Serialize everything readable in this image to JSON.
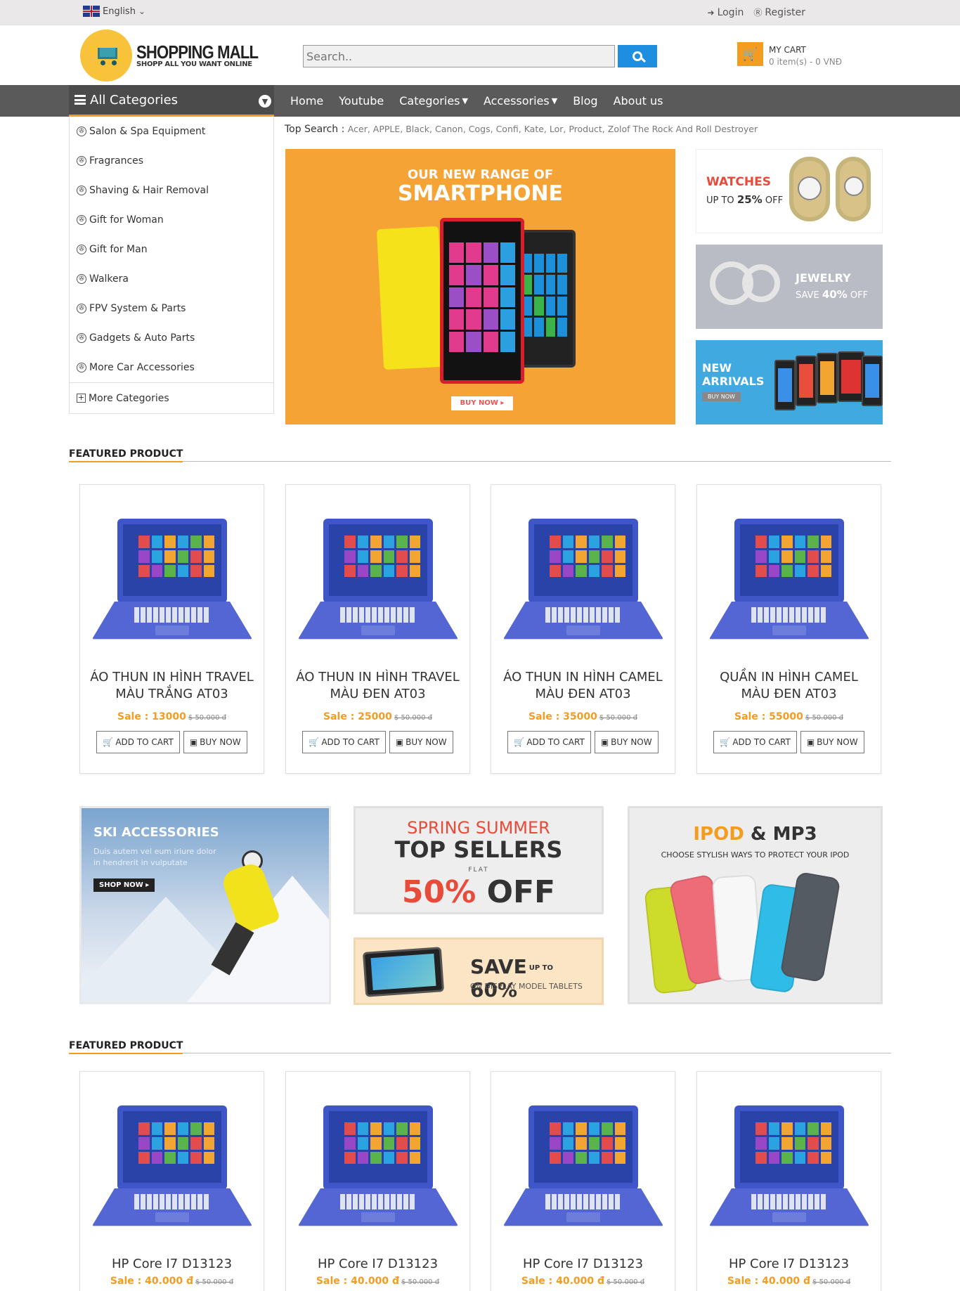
{
  "topbar": {
    "language": "English",
    "login": "Login",
    "register": "Register"
  },
  "logo": {
    "title": "SHOPPING MALL",
    "tagline": "SHOPP ALL YOU WANT ONLINE"
  },
  "search": {
    "placeholder": "Search.."
  },
  "cart": {
    "title": "MY CART",
    "summary": "0 item(s) - 0 VNĐ"
  },
  "nav": {
    "all_categories": "All Categories",
    "items": [
      "Home",
      "Youtube",
      "Categories",
      "Accessories",
      "Blog",
      "About us"
    ]
  },
  "sidebar": {
    "items": [
      "Salon & Spa Equipment",
      "Fragrances",
      "Shaving & Hair Removal",
      "Gift for Woman",
      "Gift for Man",
      "Walkera",
      "FPV System & Parts",
      "Gadgets & Auto Parts",
      "More Car Accessories"
    ],
    "more": "More Categories"
  },
  "top_search": {
    "label": "Top Search :",
    "tags": "Acer, APPLE, Black, Canon, Cogs, Confi, Kate, Lor, Product, Zolof The Rock And Roll Destroyer"
  },
  "main_banner": {
    "line1": "OUR NEW RANGE OF",
    "line2": "SMARTPHONE",
    "button": "BUY NOW"
  },
  "side_banners": {
    "watches": {
      "title": "WATCHES",
      "offer_pre": "UP TO",
      "offer_pct": "25%",
      "offer_post": "OFF"
    },
    "jewelry": {
      "title": "JEWELRY",
      "offer_pre": "SAVE",
      "offer_pct": "40%",
      "offer_post": "OFF"
    },
    "arrivals": {
      "line1": "NEW",
      "line2": "ARRIVALS",
      "button": "BUY NOW"
    }
  },
  "section1": {
    "title": "FEATURED PRODUCT",
    "products": [
      {
        "line1": "ÁO THUN IN HÌNH TRAVEL",
        "line2": "MÀU TRẮNG AT03",
        "sale": "Sale : 13000",
        "old": "$ 50.000 đ"
      },
      {
        "line1": "ÁO THUN IN HÌNH TRAVEL",
        "line2": "MÀU ĐEN AT03",
        "sale": "Sale : 25000",
        "old": "$ 50.000 đ"
      },
      {
        "line1": "ÁO THUN IN HÌNH CAMEL",
        "line2": "MÀU ĐEN AT03",
        "sale": "Sale : 35000",
        "old": "$ 50.000 đ"
      },
      {
        "line1": "QUẦN IN HÌNH CAMEL",
        "line2": "MÀU ĐEN AT03",
        "sale": "Sale : 55000",
        "old": "$ 50.000 đ"
      }
    ],
    "add_to_cart": "ADD TO CART",
    "buy_now": "BUY NOW"
  },
  "promos": {
    "ski": {
      "title": "SKI ACCESSORIES",
      "text": "Duis autem vel eum iriure dolor in hendrerit in vulputate",
      "button": "SHOP NOW"
    },
    "spring": {
      "l1": "SPRING SUMMER",
      "l2": "TOP SELLERS",
      "l3": "FLAT",
      "l4a": "50%",
      "l4b": "OFF"
    },
    "tablets": {
      "save": "SAVE",
      "upto": "UP TO",
      "pct": "60%",
      "sub": "ON DISPLAY MODEL TABLETS"
    },
    "ipod": {
      "t1": "IPOD",
      "t2": "& MP3",
      "sub": "CHOOSE STYLISH WAYS TO PROTECT YOUR IPOD",
      "label": "iPod"
    }
  },
  "section2": {
    "title": "FEATURED PRODUCT",
    "products": [
      {
        "name": "HP Core I7 D13123",
        "sale": "Sale : 40.000 đ",
        "old": "$ 50.000 đ"
      },
      {
        "name": "HP Core I7 D13123",
        "sale": "Sale : 40.000 đ",
        "old": "$ 50.000 đ"
      },
      {
        "name": "HP Core I7 D13123",
        "sale": "Sale : 40.000 đ",
        "old": "$ 50.000 đ"
      },
      {
        "name": "HP Core I7 D13123",
        "sale": "Sale : 40.000 đ",
        "old": "$ 50.000 đ"
      }
    ]
  },
  "colors": {
    "accent": "#f39c1f",
    "nav_bg": "#5a5a5a",
    "search_button": "#1e8ee0"
  }
}
